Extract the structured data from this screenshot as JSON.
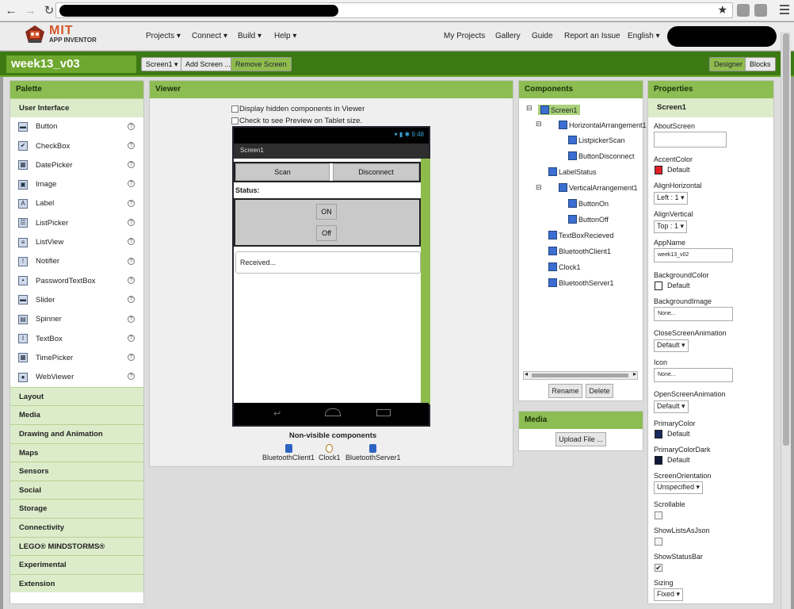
{
  "browser": {
    "star": "★"
  },
  "topnav": {
    "logo_mit": "MIT",
    "logo_sub": "APP INVENTOR",
    "menus": [
      "Projects ▾",
      "Connect ▾",
      "Build ▾",
      "Help ▾"
    ],
    "right": [
      "My Projects",
      "Gallery",
      "Guide",
      "Report an Issue",
      "English ▾"
    ]
  },
  "toolbar": {
    "project": "week13_v03",
    "screen_select": "Screen1 ▾",
    "add_screen": "Add Screen ...",
    "remove_screen": "Remove Screen",
    "designer": "Designer",
    "blocks": "Blocks"
  },
  "palette": {
    "title": "Palette",
    "active_category": "User Interface",
    "items": [
      {
        "label": "Button",
        "icon": "▬"
      },
      {
        "label": "CheckBox",
        "icon": "✔"
      },
      {
        "label": "DatePicker",
        "icon": "▦"
      },
      {
        "label": "Image",
        "icon": "▣"
      },
      {
        "label": "Label",
        "icon": "A"
      },
      {
        "label": "ListPicker",
        "icon": "☰"
      },
      {
        "label": "ListView",
        "icon": "≡"
      },
      {
        "label": "Notifier",
        "icon": "!"
      },
      {
        "label": "PasswordTextBox",
        "icon": "•"
      },
      {
        "label": "Slider",
        "icon": "▬"
      },
      {
        "label": "Spinner",
        "icon": "▤"
      },
      {
        "label": "TextBox",
        "icon": "I"
      },
      {
        "label": "TimePicker",
        "icon": "▦"
      },
      {
        "label": "WebViewer",
        "icon": "●"
      }
    ],
    "categories": [
      "Layout",
      "Media",
      "Drawing and Animation",
      "Maps",
      "Sensors",
      "Social",
      "Storage",
      "Connectivity",
      "LEGO® MINDSTORMS®",
      "Experimental",
      "Extension"
    ],
    "help": "?"
  },
  "viewer": {
    "title": "Viewer",
    "check1": "Display hidden components in Viewer",
    "check2": "Check to see Preview on Tablet size.",
    "phone": {
      "status_time": "9:48",
      "screen_title": "Screen1",
      "scan": "Scan",
      "disconnect": "Disconnect",
      "status": "Status:",
      "on": "ON",
      "off": "Off",
      "received": "Received..."
    },
    "nonvisible_title": "Non-visible components",
    "nonvisible": [
      "BluetoothClient1",
      "Clock1",
      "BluetoothServer1"
    ]
  },
  "components": {
    "title": "Components",
    "tree": [
      "Screen1",
      "HorizontalArrangement1",
      "ListpickerScan",
      "ButtonDisconnect",
      "LabelStatus",
      "VerticalArrangement1",
      "ButtonOn",
      "ButtonOff",
      "TextBoxRecieved",
      "BluetoothClient1",
      "Clock1",
      "BluetoothServer1"
    ],
    "toggle": "⊟",
    "rename": "Rename",
    "delete": "Delete",
    "scroll_left": "◂",
    "scroll_right": "▸"
  },
  "media": {
    "title": "Media",
    "upload": "Upload File ..."
  },
  "properties": {
    "title": "Properties",
    "component": "Screen1",
    "about": "AboutScreen",
    "accent": "AccentColor",
    "accent_val": "Default",
    "accent_color": "#e0202a",
    "alignh": "AlignHorizontal",
    "alignh_val": "Left : 1 ▾",
    "alignv": "AlignVertical",
    "alignv_val": "Top : 1 ▾",
    "appname": "AppName",
    "appname_val": "week13_v02",
    "bgcolor": "BackgroundColor",
    "bgcolor_val": "Default",
    "bgimage": "BackgroundImage",
    "bgimage_val": "None...",
    "close": "CloseScreenAnimation",
    "close_val": "Default ▾",
    "icon": "Icon",
    "icon_val": "None...",
    "open": "OpenScreenAnimation",
    "open_val": "Default ▾",
    "primary": "PrimaryColor",
    "primary_val": "Default",
    "primary_color": "#1a2a5c",
    "primarydark": "PrimaryColorDark",
    "primarydark_val": "Default",
    "primarydark_color": "#111a3a",
    "orientation": "ScreenOrientation",
    "orientation_val": "Unspecified ▾",
    "scrollable": "Scrollable",
    "lists": "ShowListsAsJson",
    "statusbar": "ShowStatusBar",
    "statusbar_check": "✔",
    "sizing": "Sizing",
    "sizing_val": "Fixed ▾"
  }
}
